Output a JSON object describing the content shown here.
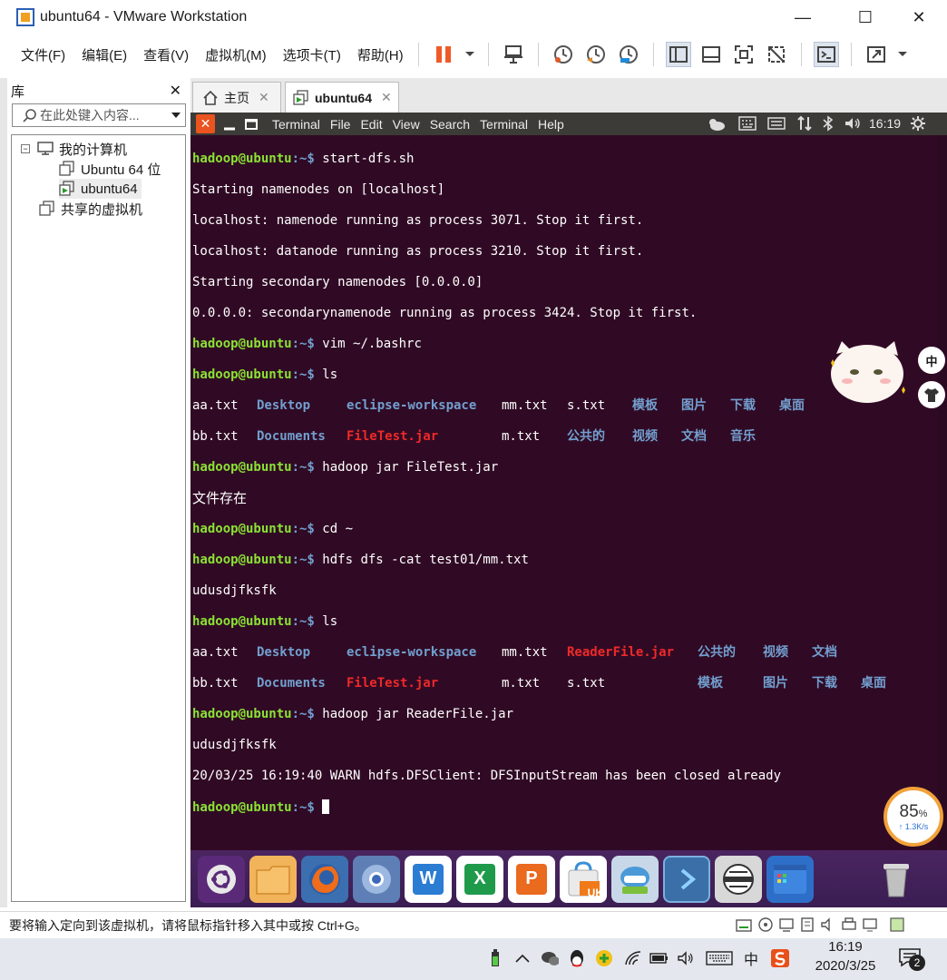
{
  "window": {
    "title": "ubuntu64 - VMware Workstation",
    "minimize": "—",
    "maximize": "☐",
    "close": "✕"
  },
  "menubar": {
    "items": [
      "文件(F)",
      "编辑(E)",
      "查看(V)",
      "虚拟机(M)",
      "选项卡(T)",
      "帮助(H)"
    ]
  },
  "library": {
    "title": "库",
    "close": "✕",
    "search_placeholder": "在此处键入内容...",
    "tree": {
      "root": "我的计算机",
      "vms": [
        "Ubuntu 64 位",
        "ubuntu64"
      ],
      "shared": "共享的虚拟机"
    }
  },
  "tabs": [
    {
      "label": "主页",
      "close": "✕"
    },
    {
      "label": "ubuntu64",
      "close": "✕"
    }
  ],
  "ubuntu": {
    "close_label": "✕",
    "terminal_menus": [
      "Terminal",
      "File",
      "Edit",
      "View",
      "Search",
      "Terminal",
      "Help"
    ],
    "time": "16:19"
  },
  "terminal": {
    "user": "hadoop@ubuntu",
    "dirs": [
      "~",
      ":~$"
    ],
    "lines": {
      "l1_cmd": " start-dfs.sh",
      "l2": "Starting namenodes on [localhost]",
      "l3": "localhost: namenode running as process 3071. Stop it first.",
      "l4": "localhost: datanode running as process 3210. Stop it first.",
      "l5": "Starting secondary namenodes [0.0.0.0]",
      "l6": "0.0.0.0: secondarynamenode running as process 3424. Stop it first.",
      "l7_cmd": " vim ~/.bashrc",
      "l8_cmd": " ls",
      "ls1": {
        "aa": "aa.txt",
        "desktop": "Desktop",
        "eclipse": "eclipse-workspace",
        "mm": "mm.txt",
        "s": "s.txt",
        "c1": "模板",
        "c2": "图片",
        "c3": "下载",
        "c4": "桌面"
      },
      "ls2": {
        "bb": "bb.txt",
        "documents": "Documents",
        "filetest": "FileTest.jar",
        "m": "m.txt",
        "c1": "公共的",
        "c2": "视频",
        "c3": "文档",
        "c4": "音乐"
      },
      "l11_cmd": " hadoop jar FileTest.jar",
      "l12": "文件存在",
      "l13_cmd": " cd ~",
      "l14_cmd": " hdfs dfs -cat test01/mm.txt",
      "l15": "udusdjfksfk",
      "l16_cmd": " ls",
      "ls3": {
        "aa": "aa.txt",
        "desktop": "Desktop",
        "eclipse": "eclipse-workspace",
        "mm": "mm.txt",
        "reader": "ReaderFile.jar",
        "c1": "公共的",
        "c2": "视频",
        "c3": "文档"
      },
      "ls4": {
        "bb": "bb.txt",
        "documents": "Documents",
        "filetest": "FileTest.jar",
        "m": "m.txt",
        "s": "s.txt",
        "c1": "模板",
        "c2": "图片",
        "c3": "下载",
        "c4": "桌面"
      },
      "l19_cmd": " hadoop jar ReaderFile.jar",
      "l20": "udusdjfksfk",
      "l21": "20/03/25 16:19:40 WARN hdfs.DFSClient: DFSInputStream has been closed already"
    }
  },
  "dock": {
    "word_label": "W",
    "excel_label": "X",
    "ppt_label": "P",
    "uk_label": "UK"
  },
  "overlay": {
    "speed_percent": "85",
    "speed_unit": "%",
    "speed_rate": "↑ 1.3K/s",
    "ime_label": "中"
  },
  "statusbar": {
    "text": "要将输入定向到该虚拟机，请将鼠标指针移入其中或按 Ctrl+G。"
  },
  "taskbar": {
    "ime": "中",
    "time": "16:19",
    "date": "2020/3/25",
    "notification_count": "2"
  },
  "colors": {
    "terminal_bg": "#300a24",
    "prompt_user": "#8ae234",
    "prompt_path": "#729fcf",
    "jar_red": "#ef2929",
    "ubuntu_orange": "#e95420"
  }
}
